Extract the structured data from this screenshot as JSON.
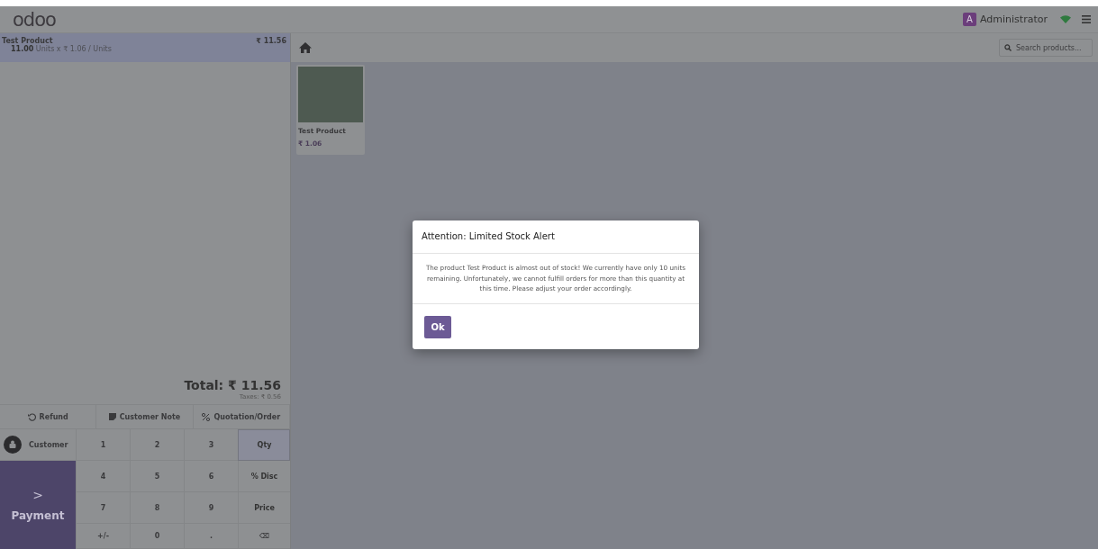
{
  "topbar": {
    "logo": "odoo",
    "user_initial": "A",
    "user_name": "Administrator",
    "connected": true
  },
  "order": {
    "lines": [
      {
        "product": "Test Product",
        "price": "₹ 11.56",
        "quantity": "11.00",
        "detail": "Units x ₹ 1.06 / Units",
        "selected": true
      }
    ],
    "total": "Total: ₹ 11.56",
    "taxes": "Taxes: ₹ 0.56"
  },
  "actions": [
    {
      "kind": "refund",
      "label": "Refund"
    },
    {
      "kind": "note",
      "label": "Customer Note"
    },
    {
      "kind": "quotation",
      "label": "Quotation/Order"
    }
  ],
  "customer_button": "Customer",
  "payment_button": {
    "arrow": ">",
    "label": "Payment"
  },
  "numpad": [
    {
      "label": "1",
      "kind": "digit",
      "selected": false
    },
    {
      "label": "2",
      "kind": "digit",
      "selected": false
    },
    {
      "label": "3",
      "kind": "digit",
      "selected": false
    },
    {
      "label": "Qty",
      "kind": "mode",
      "selected": true
    },
    {
      "label": "4",
      "kind": "digit",
      "selected": false
    },
    {
      "label": "5",
      "kind": "digit",
      "selected": false
    },
    {
      "label": "6",
      "kind": "digit",
      "selected": false
    },
    {
      "label": "% Disc",
      "kind": "mode",
      "selected": false
    },
    {
      "label": "7",
      "kind": "digit",
      "selected": false
    },
    {
      "label": "8",
      "kind": "digit",
      "selected": false
    },
    {
      "label": "9",
      "kind": "digit",
      "selected": false
    },
    {
      "label": "Price",
      "kind": "mode",
      "selected": false
    },
    {
      "label": "+/-",
      "kind": "digit",
      "selected": false
    },
    {
      "label": "0",
      "kind": "digit",
      "selected": false
    },
    {
      "label": ".",
      "kind": "digit",
      "selected": false
    },
    {
      "label": "⌫",
      "kind": "digit",
      "selected": false
    }
  ],
  "search": {
    "placeholder": "Search products..."
  },
  "products": [
    {
      "name": "Test Product",
      "price": "₹ 1.06"
    }
  ],
  "dialog": {
    "title": "Attention: Limited Stock Alert",
    "message": "The product Test Product is almost out of stock! We currently have only 10 units remaining. Unfortunately, we cannot fulfill orders for more than this quantity at this time. Please adjust your order accordingly.",
    "button": "Ok"
  }
}
